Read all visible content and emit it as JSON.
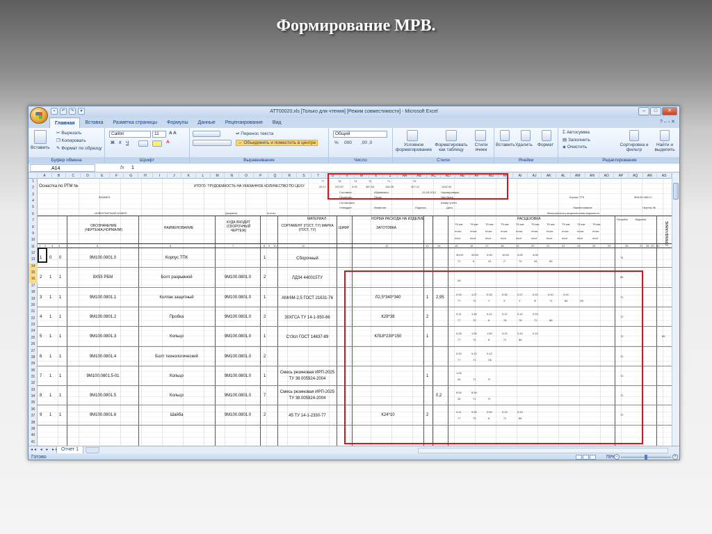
{
  "slide": {
    "title": "Формирование МРВ."
  },
  "window": {
    "title": "АТТ00020.xls  [Только для чтения]  [Режим совместимости] - Microsoft Excel",
    "tabs": [
      "Главная",
      "Вставка",
      "Разметка страницы",
      "Формулы",
      "Данные",
      "Рецензирование",
      "Вид"
    ]
  },
  "ribbon": {
    "clipboard": {
      "paste": "Вставить",
      "cut": "Вырезать",
      "copy": "Копировать",
      "format_painter": "Формат по образцу",
      "label": "Буфер обмена"
    },
    "font": {
      "name": "Calibri",
      "size": "11",
      "label": "Шрифт",
      "bold": "Ж",
      "italic": "К",
      "underline": "Ч"
    },
    "alignment": {
      "wrap": "Перенос текста",
      "merge": "Объединить и поместить в центре",
      "label": "Выравнивание"
    },
    "number": {
      "format": "Общий",
      "label": "Число",
      "pct": "%",
      "thousands": "000"
    },
    "styles": {
      "conditional": "Условное форматирование",
      "as_table": "Форматировать как таблицу",
      "cell_styles": "Стили ячеек",
      "label": "Стили"
    },
    "cells": {
      "insert": "Вставить",
      "delete": "Удалить",
      "format": "Формат",
      "label": "Ячейки"
    },
    "editing": {
      "autosum": "Автосумма",
      "fill": "Заполнить",
      "clear": "Очистить",
      "sort": "Сортировка и фильтр",
      "find": "Найти и выделить",
      "label": "Редактирование"
    }
  },
  "formula_bar": {
    "cell_ref": "A14",
    "fx": "fx",
    "value": "1"
  },
  "columns": [
    "A",
    "B",
    "C",
    "D",
    "E",
    "F",
    "G",
    "H",
    "I",
    "J",
    "K",
    "L",
    "M",
    "N",
    "O",
    "P",
    "Q",
    "R",
    "S",
    "T",
    "U",
    "V",
    "W",
    "X",
    "Z",
    "AA",
    "AB",
    "AC",
    "AD",
    "AE",
    "AF",
    "AG",
    "AH",
    "AI",
    "AJ",
    "AK",
    "AL",
    "AM",
    "AN",
    "AO",
    "AP",
    "AQ",
    "AR",
    "AS"
  ],
  "header_cells": {
    "r2_left": "Оснастка по РТМ №",
    "r2_mid": "ИТОГО: ТРУДОЕМКОСТЬ НА УКАЗАННОЕ КОЛИЧЕСТВО ПО ЦЕХУ",
    "top_nums_1": [
      "77",
      "78",
      "74",
      "72",
      "71",
      "75"
    ],
    "top_nums_2": [
      "33.17",
      "220.57",
      "4.00",
      "387.54",
      "118.55",
      "327.12",
      "1542.00"
    ],
    "sostavil": "Составил",
    "avramovich": "Абрамович",
    "date1": "31.05.2012",
    "normirovschik": "Нормировщик",
    "proveril": "Проверил",
    "pechik": "Печик",
    "nach_buro": "Нач.бюро",
    "soglasoval": "Согласовал",
    "shifr_ucheta": "Шифр учета",
    "utverdil": "Утвердил",
    "familiya": "Фамилия",
    "podpis": "Подпись",
    "data": "Дата",
    "korpus_ttk": "Корпус ТТК",
    "order_code": "9М100.0801.0",
    "vzamen": "ВЗАМЕН",
    "naimenovanie": "Наименование",
    "chertezh": "Чертеж №",
    "inv_nomer": "ИНВЕНТАРНЫЙ НОМЕР",
    "dokument": "Документ",
    "kol_vo": "Кол-во",
    "mat_ved": "Материально-расцеховочная ведомость",
    "material": "МАТЕРИАЛ",
    "norma": "НОРМА РАСХОДА НА ИЗДЕЛИЕ",
    "rascekhovka": "РАСЦЕХОВКА",
    "oboznachenie": "ОБОЗНАЧЕНИЕ (ЧЕРТЕЖА,НОРМАЛИ)",
    "naim_col": "НАИМЕНОВАНИЕ",
    "kuda": "КУДА ВХОДИТ (СБОРОЧНЫЙ ЧЕРТЕЖ)",
    "sortament": "СОРТАМЕНТ (ГОСТ, ТУ) МАРКА (ГОСТ, ТУ)",
    "shifr": "ШИФР",
    "zagotovka": "ЗАГОТОВКА",
    "potreb": "Потреби",
    "primechanie": "ПРИМЕЧАНИЕ",
    "varianty": "Вариант",
    "col_nums": [
      "1",
      "2",
      "3",
      "4",
      "5",
      "6",
      "7",
      "8",
      "9",
      "10",
      "11",
      "12",
      "13",
      "14",
      "15",
      "16",
      "17",
      "18",
      "19",
      "20",
      "21",
      "22",
      "23",
      "24",
      "25",
      "26",
      "27",
      "28",
      "29",
      "30",
      "31"
    ],
    "tsekh": "Т5 кат.",
    "nch": "н/час",
    "nshtuk": "н/шт"
  },
  "rows": [
    {
      "r": "15",
      "a": "1",
      "b": "0",
      "c": "0",
      "code": "9М100.0801.0",
      "name": "Корпус ТПК",
      "parent": "",
      "qty": "1",
      "material": "Сборочный",
      "zag": "",
      "n": "",
      "v": "",
      "vals": [
        "30:00",
        "33:00",
        "2:00",
        "10:00",
        "4:00",
        "4:00"
      ],
      "vals2": [
        "71",
        "6",
        "41",
        "Л",
        "74",
        "44",
        "85"
      ],
      "n17": "74",
      "note": ""
    },
    {
      "r": "18",
      "a": "2",
      "b": "1",
      "c": "1",
      "code": "8Х55 РБМ",
      "name": "Болт разрывной",
      "parent": "9М100.0801.0",
      "qty": "2",
      "material": "ЛДЗ4 440015ТУ",
      "zag": "",
      "n": "",
      "v": "",
      "vals": [],
      "vals2": [
        "26"
      ],
      "n17": "85",
      "note": ""
    },
    {
      "r": "21",
      "a": "3",
      "b": "1",
      "c": "1",
      "code": "9М100.0801.1",
      "name": "Колпак защитный",
      "parent": "9М100.0801.0",
      "qty": "1",
      "material": "АМг6М-2,5 ГОСТ 21631-76",
      "zag": "Л2,5*340*340",
      "n": "1",
      "v": "2,95",
      "vals": [
        "0:16",
        "1:27",
        "0:33",
        "0:30",
        "0:27",
        "0:10",
        "0:10",
        "0:10"
      ],
      "vals2": [
        "77",
        "72",
        "Y",
        "X",
        "Y",
        "Ф",
        "71",
        "86",
        "Л6"
      ],
      "n17": "72",
      "note": ""
    },
    {
      "r": "24",
      "a": "4",
      "b": "1",
      "c": "1",
      "code": "9М100.0801.2",
      "name": "Пробка",
      "parent": "9М100.0801.0",
      "qty": "2",
      "material": "30ХГСА ТУ 14-1-950-86",
      "zag": "К28*38",
      "n": "2",
      "v": "",
      "vals": [
        "0:11",
        "1:40",
        "0:12",
        "0:12",
        "0:10",
        "0:10"
      ],
      "vals2": [
        "77",
        "70",
        "8",
        "76",
        "78",
        "71",
        "86"
      ],
      "n17": "72",
      "note": ""
    },
    {
      "r": "27",
      "a": "5",
      "b": "1",
      "c": "1",
      "code": "9М100.0801.3",
      "name": "Кольцо",
      "parent": "9М100.0801.0",
      "qty": "1",
      "material": "Ст3сп ГОСТ 14637-89",
      "zag": "КЛ18*230*150",
      "n": "1",
      "v": "",
      "vals": [
        "0:28",
        "1:50",
        "1:50",
        "0:20",
        "0:10",
        "0:10"
      ],
      "vals2": [
        "77",
        "70",
        "8",
        "71",
        "86"
      ],
      "n17": "72",
      "note": "85"
    },
    {
      "r": "30",
      "a": "6",
      "b": "1",
      "c": "1",
      "code": "9М100.0801.4",
      "name": "Болт технологический",
      "parent": "9М100.0801.0",
      "qty": "2",
      "material": "",
      "zag": "",
      "n": "",
      "v": "",
      "vals": [
        "0:20",
        "0:12",
        "0:12"
      ],
      "vals2": [
        "77",
        "71",
        "Л6"
      ],
      "n17": "72",
      "note": ""
    },
    {
      "r": "33",
      "a": "7",
      "b": "1",
      "c": "1",
      "code": "9М100.0801.5-01",
      "name": "Кольцо",
      "parent": "9М100.0801.0",
      "qty": "1",
      "material": "Смесь резиновая ИРП-2025 ТУ 38.005924-2004",
      "zag": "",
      "n": "1",
      "v": "",
      "vals": [
        "1:05"
      ],
      "vals2": [
        "26",
        "71",
        "Я"
      ],
      "n17": "72",
      "note": ""
    },
    {
      "r": "36",
      "a": "8",
      "b": "1",
      "c": "1",
      "code": "9М100.0801.5",
      "name": "Кольцо",
      "parent": "9М100.0801.0",
      "qty": "7",
      "material": "Смесь резиновая ИРП-2025 ТУ 38.005924-2004",
      "zag": "",
      "n": "",
      "v": "0,2",
      "vals": [
        "6:54",
        "6:54"
      ],
      "vals2": [
        "26",
        "71",
        "Я"
      ],
      "n17": "72",
      "note": ""
    },
    {
      "r": "39",
      "a": "9",
      "b": "1",
      "c": "1",
      "code": "9М100.0801.6",
      "name": "Шайба",
      "parent": "9М100.0801.0",
      "qty": "2",
      "material": "45 ТУ 14-1-2330-77",
      "zag": "К24*10",
      "n": "2",
      "v": "",
      "vals": [
        "0:11",
        "0:50",
        "0:50",
        "0:10",
        "0:10"
      ],
      "vals2": [
        "77",
        "70",
        "8",
        "71",
        "86"
      ],
      "n17": "72",
      "note": ""
    }
  ],
  "row_numbers": [
    "1",
    "2",
    "3",
    "4",
    "5",
    "6",
    "7",
    "8",
    "9",
    "10",
    "11",
    "12",
    "13",
    "14",
    "15",
    "16",
    "17",
    "18",
    "19",
    "20",
    "21",
    "22",
    "23",
    "24",
    "25",
    "26",
    "27",
    "28",
    "29",
    "30",
    "31",
    "32",
    "33",
    "34",
    "35",
    "36",
    "37",
    "38",
    "39",
    "40",
    "41"
  ],
  "sheet_tab": "Отчет 1",
  "status": {
    "ready": "Готово",
    "zoom": "78%",
    "zoom_value": 78
  }
}
